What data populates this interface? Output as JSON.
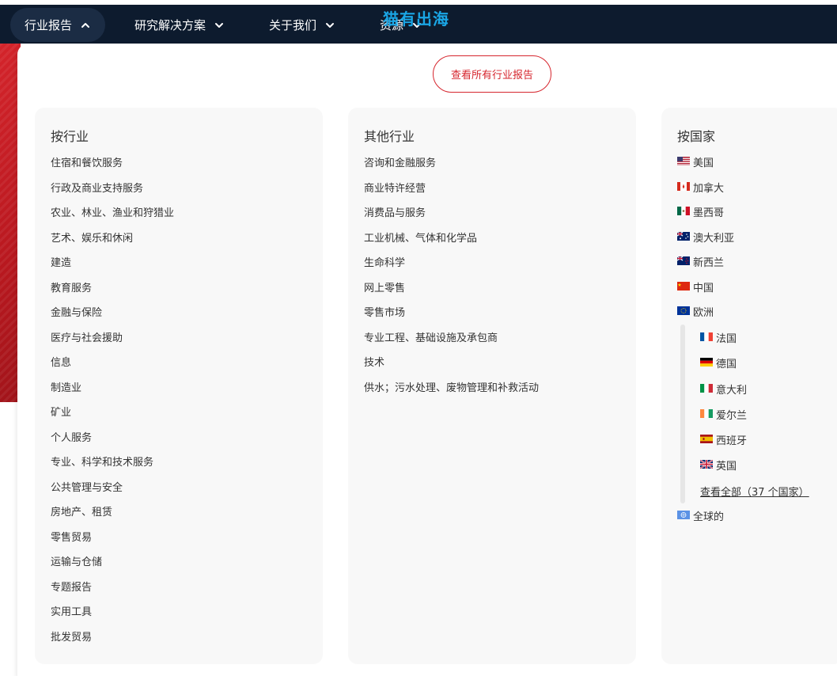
{
  "nav": {
    "items": [
      {
        "label": "行业报告",
        "state": "expanded"
      },
      {
        "label": "研究解决方案"
      },
      {
        "label": "关于我们"
      },
      {
        "label": "资源"
      }
    ]
  },
  "watermark": "猫有出海",
  "cta": {
    "label": "查看所有行业报告"
  },
  "columns": {
    "industry": {
      "title": "按行业",
      "items": [
        "住宿和餐饮服务",
        "行政及商业支持服务",
        "农业、林业、渔业和狩猎业",
        "艺术、娱乐和休闲",
        "建造",
        "教育服务",
        "金融与保险",
        "医疗与社会援助",
        "信息",
        "制造业",
        "矿业",
        "个人服务",
        "专业、科学和技术服务",
        "公共管理与安全",
        "房地产、租赁",
        "零售贸易",
        "运输与仓储",
        "专题报告",
        "实用工具",
        "批发贸易"
      ]
    },
    "other": {
      "title": "其他行业",
      "items": [
        "咨询和金融服务",
        "商业特许经营",
        "消费品与服务",
        "工业机械、气体和化学品",
        "生命科学",
        "网上零售",
        "零售市场",
        "专业工程、基础设施及承包商",
        "技术",
        "供水；污水处理、废物管理和补救活动"
      ]
    },
    "country": {
      "title": "按国家",
      "items": [
        {
          "label": "美国",
          "flag": "us-flag-icon"
        },
        {
          "label": "加拿大",
          "flag": "ca-flag-icon"
        },
        {
          "label": "墨西哥",
          "flag": "mx-flag-icon"
        },
        {
          "label": "澳大利亚",
          "flag": "au-flag-icon"
        },
        {
          "label": "新西兰",
          "flag": "nz-flag-icon"
        },
        {
          "label": "中国",
          "flag": "cn-flag-icon"
        },
        {
          "label": "欧洲",
          "flag": "eu-flag-icon"
        }
      ],
      "europe": [
        {
          "label": "法国",
          "flag": "fr-flag-icon"
        },
        {
          "label": "德国",
          "flag": "de-flag-icon"
        },
        {
          "label": "意大利",
          "flag": "it-flag-icon"
        },
        {
          "label": "爱尔兰",
          "flag": "ie-flag-icon"
        },
        {
          "label": "西班牙",
          "flag": "es-flag-icon"
        },
        {
          "label": "英国",
          "flag": "gb-flag-icon"
        }
      ],
      "view_all": "查看全部（37 个国家）",
      "global": {
        "label": "全球的",
        "flag": "globe-flag-icon"
      }
    }
  },
  "colors": {
    "nav_bg": "#0d1b2e",
    "accent_red": "#d6262e",
    "column_bg": "#f8f8f8",
    "watermark": "#1aa6e6"
  }
}
